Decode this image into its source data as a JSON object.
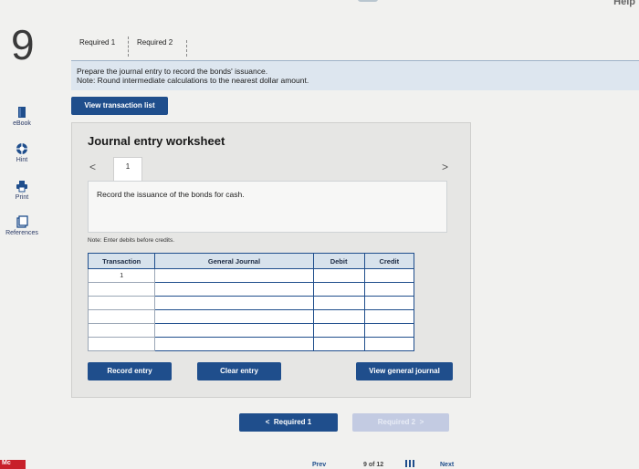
{
  "question_number": "9",
  "help_label": "Help",
  "sidebar": [
    {
      "label": "eBook",
      "icon": "book-icon"
    },
    {
      "label": "Hint",
      "icon": "hint-icon"
    },
    {
      "label": "Print",
      "icon": "print-icon"
    },
    {
      "label": "References",
      "icon": "references-icon"
    }
  ],
  "tabs": [
    "Required 1",
    "Required 2"
  ],
  "instructions": {
    "line1": "Prepare the journal entry to record the bonds' issuance.",
    "line2": "Note: Round intermediate calculations to the nearest dollar amount."
  },
  "view_transaction_list": "View transaction list",
  "worksheet": {
    "title": "Journal entry worksheet",
    "page": "1",
    "prev_arrow": "<",
    "next_arrow": ">",
    "description": "Record the issuance of the bonds for cash.",
    "note": "Note: Enter debits before credits.",
    "headers": [
      "Transaction",
      "General Journal",
      "Debit",
      "Credit"
    ],
    "first_transaction": "1"
  },
  "buttons": {
    "record_entry": "Record entry",
    "clear_entry": "Clear entry",
    "view_general_journal": "View general journal"
  },
  "nav": {
    "prev_label": "Required 1",
    "prev_arrow": "<",
    "next_label": "Required 2",
    "next_arrow": ">"
  },
  "footer": {
    "prev_partial": "Prev",
    "page_partial": "9 of 12",
    "next_partial": "Next",
    "logo": "Mc"
  },
  "colors": {
    "accent": "#1f4e8c",
    "instruction_bg": "#dde6ef"
  }
}
